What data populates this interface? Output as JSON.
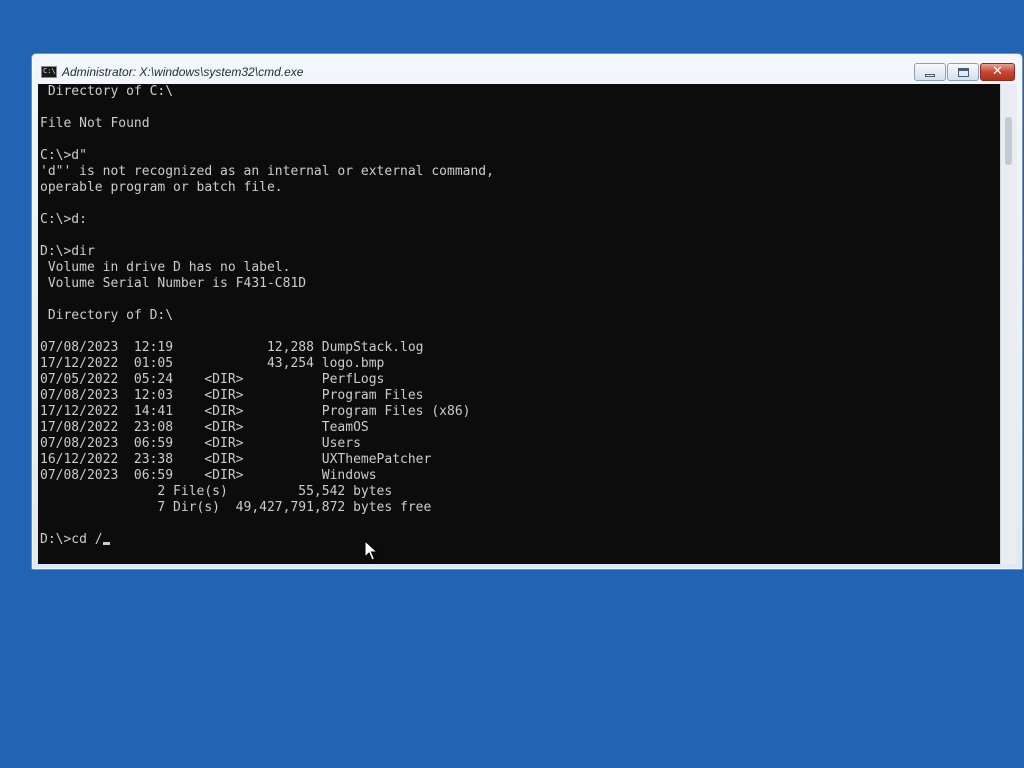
{
  "window": {
    "title": "Administrator: X:\\windows\\system32\\cmd.exe",
    "icon_label": "C:\\",
    "controls": {
      "minimize": "minimize-icon",
      "maximize": "maximize-icon",
      "close": "✕"
    }
  },
  "console": {
    "lines": [
      " Directory of C:\\",
      "",
      "File Not Found",
      "",
      "C:\\>d\"",
      "'d\"' is not recognized as an internal or external command,",
      "operable program or batch file.",
      "",
      "C:\\>d:",
      "",
      "D:\\>dir",
      " Volume in drive D has no label.",
      " Volume Serial Number is F431-C81D",
      "",
      " Directory of D:\\",
      "",
      "07/08/2023  12:19            12,288 DumpStack.log",
      "17/12/2022  01:05            43,254 logo.bmp",
      "07/05/2022  05:24    <DIR>          PerfLogs",
      "07/08/2023  12:03    <DIR>          Program Files",
      "17/12/2022  14:41    <DIR>          Program Files (x86)",
      "17/08/2022  23:08    <DIR>          TeamOS",
      "07/08/2023  06:59    <DIR>          Users",
      "16/12/2022  23:38    <DIR>          UXThemePatcher",
      "07/08/2023  06:59    <DIR>          Windows",
      "               2 File(s)         55,542 bytes",
      "               7 Dir(s)  49,427,791,872 bytes free",
      ""
    ],
    "prompt": "D:\\>cd /"
  },
  "colors": {
    "desktop": "#2264b4",
    "console_bg": "#0c0c0c",
    "console_fg": "#cccccc",
    "close_button": "#c8452f"
  }
}
